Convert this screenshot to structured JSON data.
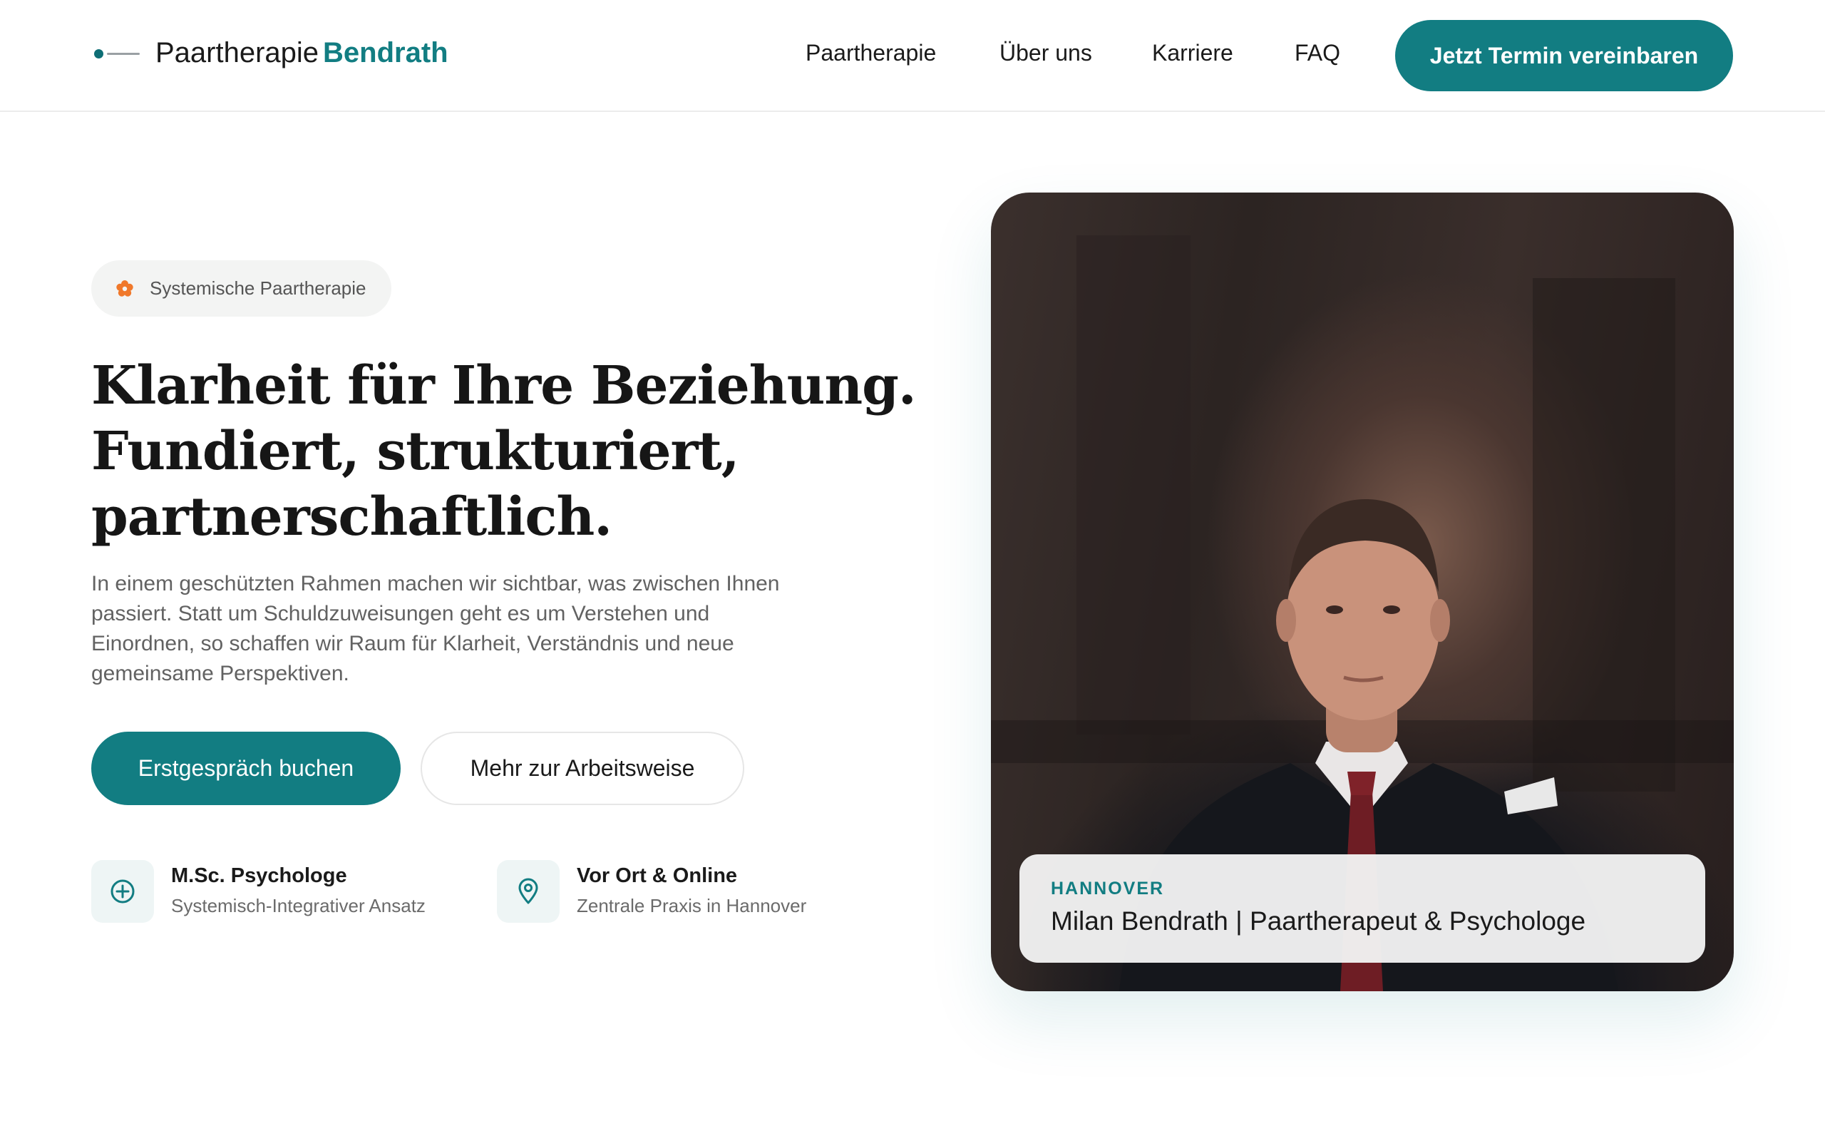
{
  "header": {
    "logo_text_regular": "Paartherapie",
    "logo_text_bold": "Bendrath",
    "nav": [
      "Paartherapie",
      "Über uns",
      "Karriere",
      "FAQ"
    ],
    "cta_label": "Jetzt Termin vereinbaren"
  },
  "hero": {
    "badge_label": "Systemische Paartherapie",
    "headline": [
      "Klarheit für Ihre Beziehung.",
      "Fundiert, strukturiert,",
      "partnerschaftlich."
    ],
    "lead": "In einem geschützten Rahmen machen wir sichtbar, was zwischen Ihnen passiert. Statt um Schuldzuweisungen geht es um Verstehen und Einordnen, so schaffen wir Raum für Klarheit, Verständnis und neue gemeinsame Perspektiven.",
    "primary_button": "Erstgespräch buchen",
    "secondary_button": "Mehr zur Arbeitsweise",
    "features": [
      {
        "title": "M.Sc. Psychologe",
        "subtitle": "Systemisch-Integrativer Ansatz",
        "icon": "plus-circle-icon"
      },
      {
        "title": "Vor Ort & Online",
        "subtitle": "Zentrale Praxis in Hannover",
        "icon": "map-pin-icon"
      }
    ]
  },
  "photo": {
    "location": "HANNOVER",
    "caption": "Milan Bendrath | Paartherapeut & Psychologe"
  },
  "colors": {
    "accent": "#127d82",
    "badge_icon": "#f0782a",
    "text_dark": "#1a1a1a",
    "text_muted": "#626262"
  }
}
